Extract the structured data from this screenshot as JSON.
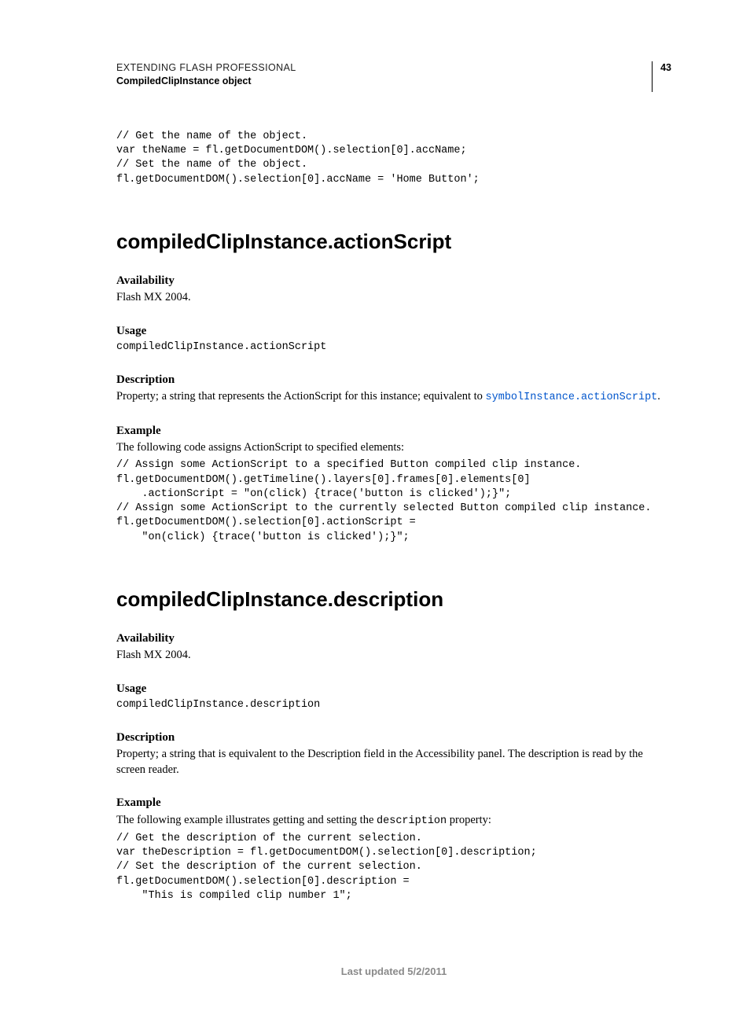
{
  "header": {
    "product": "EXTENDING FLASH PROFESSIONAL",
    "subject": "CompiledClipInstance object",
    "page_number": "43"
  },
  "intro_code": "// Get the name of the object.\nvar theName = fl.getDocumentDOM().selection[0].accName;\n// Set the name of the object.\nfl.getDocumentDOM().selection[0].accName = 'Home Button';",
  "section1": {
    "title": "compiledClipInstance.actionScript",
    "availability_label": "Availability",
    "availability_text": "Flash MX 2004.",
    "usage_label": "Usage",
    "usage_code": "compiledClipInstance.actionScript",
    "description_label": "Description",
    "description_prefix": "Property; a string that represents the ActionScript for this instance; equivalent to ",
    "description_link": "symbolInstance.actionScript",
    "description_suffix": ".",
    "example_label": "Example",
    "example_intro": "The following code assigns ActionScript to specified elements:",
    "example_code": "// Assign some ActionScript to a specified Button compiled clip instance.\nfl.getDocumentDOM().getTimeline().layers[0].frames[0].elements[0]\n    .actionScript = \"on(click) {trace('button is clicked');}\";\n// Assign some ActionScript to the currently selected Button compiled clip instance.\nfl.getDocumentDOM().selection[0].actionScript =\n    \"on(click) {trace('button is clicked');}\";"
  },
  "section2": {
    "title": "compiledClipInstance.description",
    "availability_label": "Availability",
    "availability_text": "Flash MX 2004.",
    "usage_label": "Usage",
    "usage_code": "compiledClipInstance.description",
    "description_label": "Description",
    "description_text": "Property; a string that is equivalent to the Description field in the Accessibility panel. The description is read by the screen reader.",
    "example_label": "Example",
    "example_intro_prefix": "The following example illustrates getting and setting the ",
    "example_intro_code": "description",
    "example_intro_suffix": " property:",
    "example_code": "// Get the description of the current selection.\nvar theDescription = fl.getDocumentDOM().selection[0].description;\n// Set the description of the current selection.\nfl.getDocumentDOM().selection[0].description =\n    \"This is compiled clip number 1\";"
  },
  "footer": "Last updated 5/2/2011"
}
